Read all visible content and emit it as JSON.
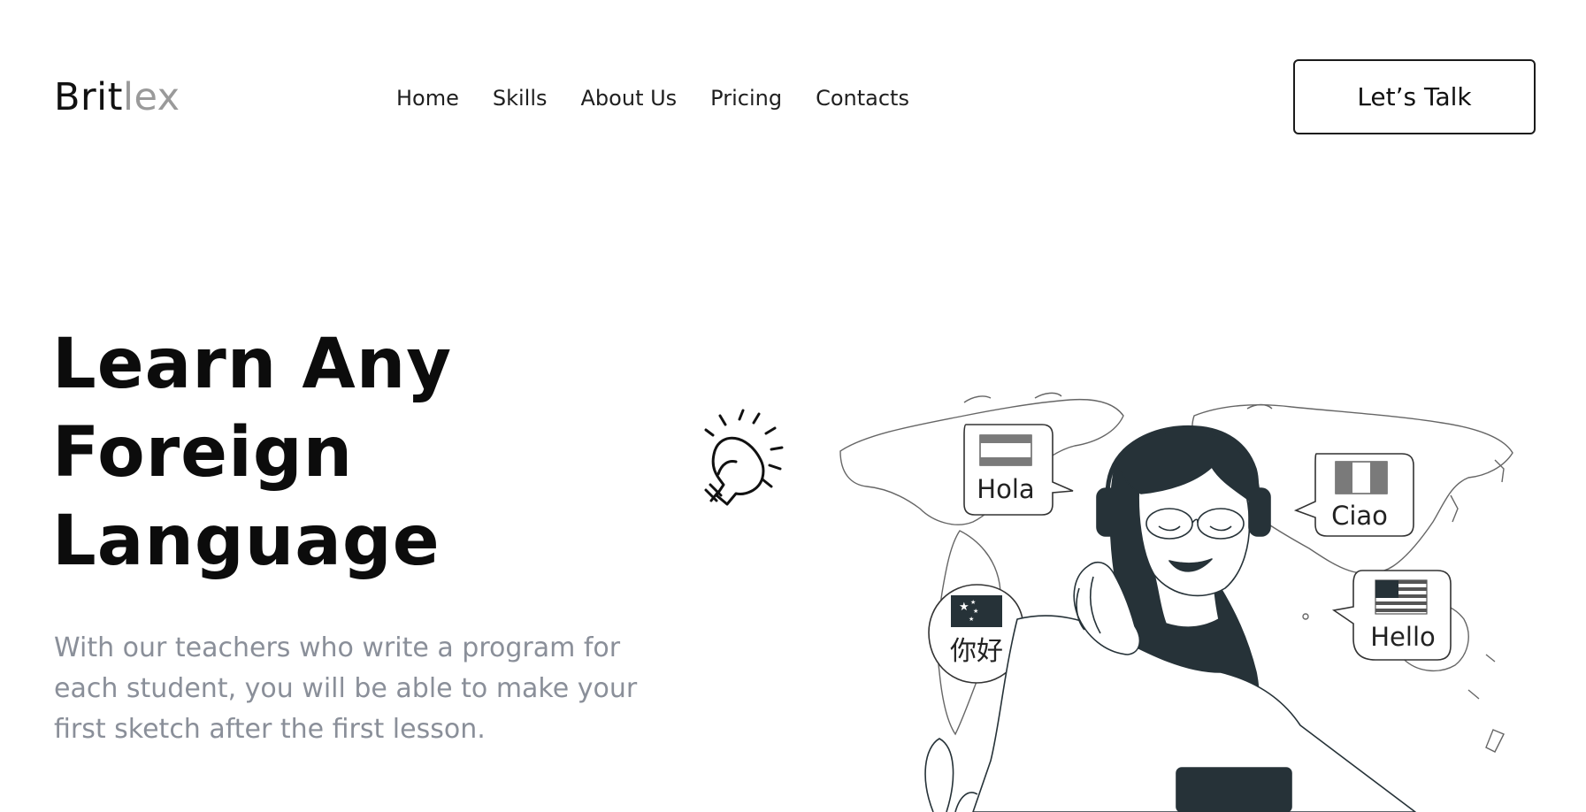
{
  "logo": {
    "part1": "Brit",
    "part2": "lex"
  },
  "nav": {
    "items": [
      "Home",
      "Skills",
      "About Us",
      "Pricing",
      "Contacts"
    ]
  },
  "cta": {
    "label": "Let’s Talk"
  },
  "hero": {
    "title_lines": [
      "Learn Any",
      "Foreign",
      "Language"
    ],
    "description_lines": [
      "With our teachers who write a program for",
      "each student, you will be able to make your",
      "first sketch after the first lesson."
    ]
  },
  "illustration": {
    "bubbles": {
      "spanish": "Hola",
      "italian": "Ciao",
      "chinese": "你好",
      "english": "Hello"
    }
  },
  "colors": {
    "text_dark": "#111111",
    "logo_light": "#9a9a9a",
    "paragraph": "#8a8f99",
    "ink": "#263238"
  }
}
